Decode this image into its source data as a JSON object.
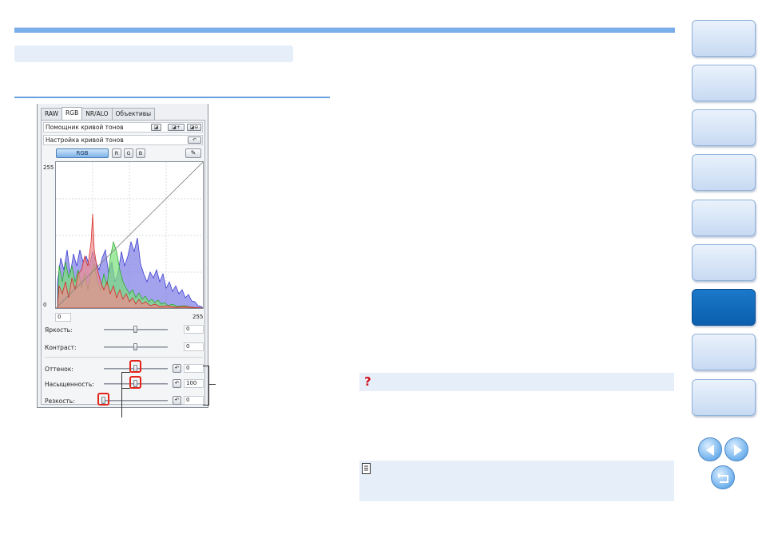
{
  "tabs": [
    "RAW",
    "RGB",
    "NR/ALO",
    "Объективы"
  ],
  "active_tab": "RGB",
  "tone_curve_assist": {
    "label": "Помощник кривой тонов"
  },
  "tone_curve_adjust": {
    "label": "Настройка кривой тонов"
  },
  "channels": {
    "rgb": "RGB",
    "r": "R",
    "g": "G",
    "b": "B"
  },
  "graph": {
    "axis_top": "255",
    "axis_left_zero": "0",
    "input_value": "0",
    "axis_bottom_max": "255"
  },
  "sliders": {
    "brightness": {
      "label": "Яркость:",
      "value": "0",
      "level": 0.5
    },
    "contrast": {
      "label": "Контраст:",
      "value": "0",
      "level": 0.5
    },
    "hue": {
      "label": "Оттенок:",
      "value": "0",
      "level": 0.5
    },
    "saturation": {
      "label": "Насыщенность:",
      "value": "100",
      "level": 0.5
    },
    "sharpness": {
      "label": "Резкость:",
      "value": "0",
      "level": 0.0
    }
  },
  "colors": {
    "accent": "#7aaee8",
    "active_nav": "#0b5fae",
    "highlight": "#e2231a",
    "hist_red": "#e0302a",
    "hist_green": "#3cc23c",
    "hist_blue": "#4040d0"
  },
  "icons": {
    "question": "?",
    "note": "note-icon"
  },
  "side_nav": {
    "active_index": 6,
    "count": 9
  }
}
